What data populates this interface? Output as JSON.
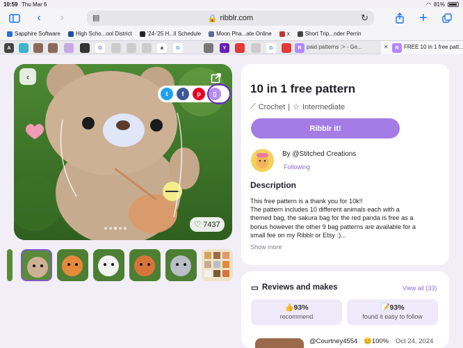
{
  "status": {
    "time": "10:59",
    "date": "Thu Mar 6",
    "battery": "81%"
  },
  "browser": {
    "url": "ribblr.com",
    "bookmarks": [
      "Sapphire Software",
      "High Scho...ool District",
      "'24-'25 H...ll Schedule",
      "Moon Pha...ate Online",
      "x",
      "Short Trip...nder Perrin"
    ],
    "tab_paid": "paid patterns :> - Ge...",
    "tab_active": "FREE 10 in 1 free patt..."
  },
  "photo": {
    "likes": "7437"
  },
  "pattern": {
    "title": "10 in 1 free pattern",
    "craft": "Crochet",
    "separator": "|",
    "level": "Intermediate",
    "cta": "Ribblr it!",
    "author": "By @Stitched Creations",
    "following": "Following",
    "desc_heading": "Description",
    "desc_lines": [
      "This free pattern is a thank you for 10k!!",
      "The pattern includes 10 different animals each with a",
      "themed bag, the sakura bag for the red panda is free as a",
      "bonus however the other 9 bag patterns are available for a",
      "small fee on my Ribblr or Etsy :)..."
    ],
    "show_more": "Show more"
  },
  "reviews": {
    "heading": "Reviews and makes",
    "view_all": "View all (33)",
    "stat1_value": "👍93%",
    "stat1_label": "recommend",
    "stat2_value": "📝93%",
    "stat2_label": "found it easy to follow",
    "first_user": "@Courtney4554",
    "first_pct": "😊100%",
    "first_date": "Oct 24, 2024"
  },
  "colors": {
    "accent": "#a57be6",
    "link": "#8b6ad2",
    "page_bg": "#f2eef8"
  }
}
